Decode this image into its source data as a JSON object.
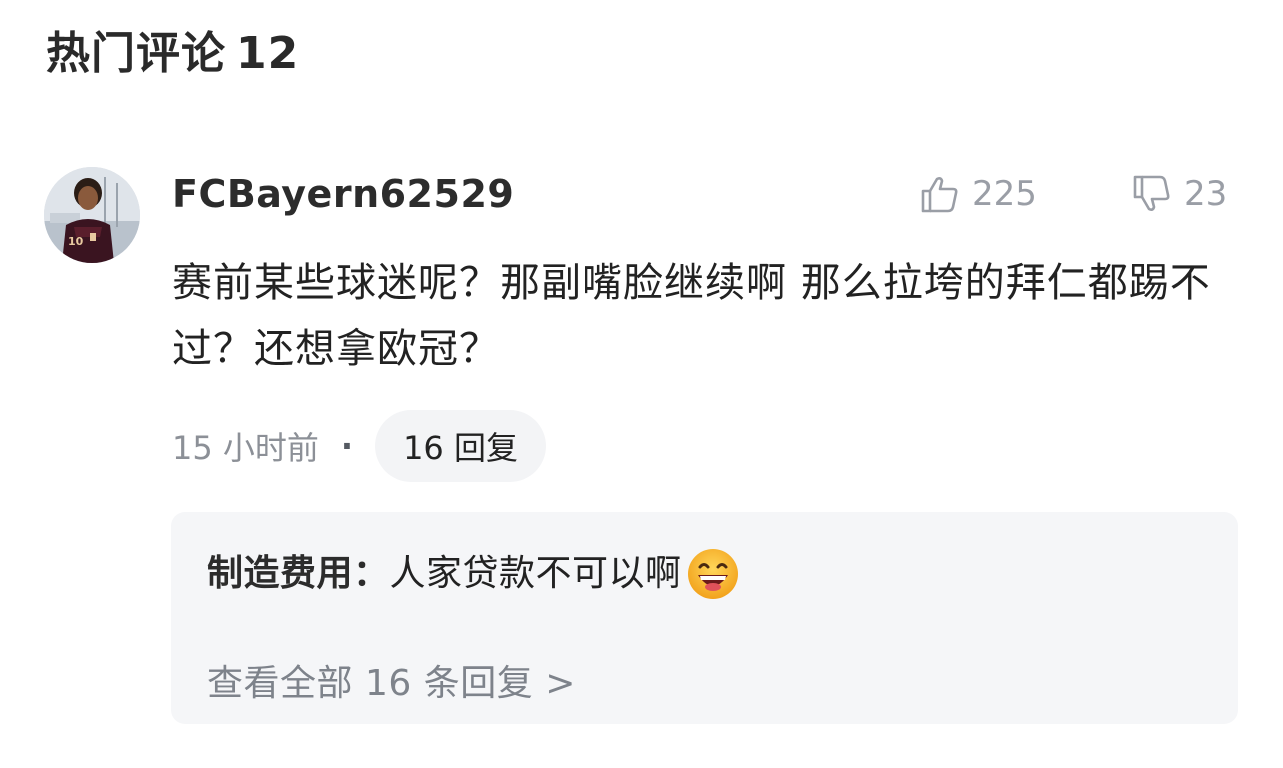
{
  "section": {
    "title": "热门评论",
    "count": "12"
  },
  "comment": {
    "author": "FCBayern62529",
    "likes": "225",
    "dislikes": "23",
    "text": "赛前某些球迷呢？那副嘴脸继续啊 那么拉垮的拜仁都踢不过？还想拿欧冠？",
    "time": "15 小时前",
    "separator": "·",
    "reply_button": "16 回复"
  },
  "reply_preview": {
    "author": "制造费用：",
    "text": "人家贷款不可以啊",
    "emoji_icon": "grinning-face-emoji",
    "view_all": "查看全部 16 条回复",
    "view_all_chevron": ">"
  },
  "colors": {
    "muted_text": "#8c9097",
    "pill_background": "#f3f4f6",
    "reply_background": "#f5f6f8",
    "icon_gray": "#9a9ea6"
  }
}
